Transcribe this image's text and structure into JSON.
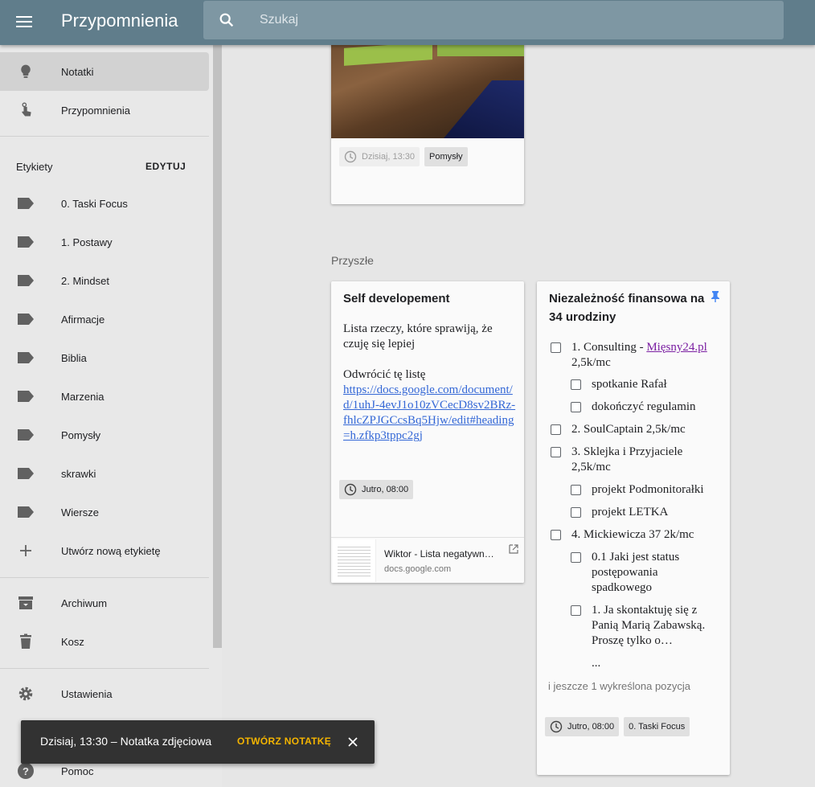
{
  "header": {
    "title": "Przypomnienia",
    "search_placeholder": "Szukaj"
  },
  "sidebar": {
    "notes": "Notatki",
    "reminders": "Przypomnienia",
    "labels_heading": "Etykiety",
    "edit_label": "EDYTUJ",
    "labels": [
      "0. Taski Focus",
      "1. Postawy",
      "2. Mindset",
      "Afirmacje",
      "Biblia",
      "Marzenia",
      "Pomysły",
      "skrawki",
      "Wiersze"
    ],
    "create_label": "Utwórz nową etykietę",
    "archive": "Archiwum",
    "trash": "Kosz",
    "settings": "Ustawienia",
    "help": "Pomoc"
  },
  "photo_card": {
    "time_chip": "Dzisiaj, 13:30",
    "label_chip": "Pomysły"
  },
  "section_past": "Przyszłe",
  "self_card": {
    "title": "Self developement",
    "line1": "Lista rzeczy, które sprawiją, że czuję się lepiej",
    "line2": "Odwrócić tę listę",
    "url": "https://docs.google.com/document/d/1uhJ-4evJ1o10zVCecD8sv2BRz-fhlcZPJGCcsBq5Hjw/edit#heading=h.zfkp3tppc2gj",
    "time_chip": "Jutro, 08:00",
    "preview_title": "Wiktor - Lista negatywn…",
    "preview_domain": "docs.google.com"
  },
  "finance_card": {
    "title": "Niezależność finansowa na 34 urodziny",
    "items": {
      "i1_prefix": "1. Consulting - ",
      "i1_link": "Mięsny24.pl",
      "i1_suffix": "2,5k/mc",
      "i1a": "spotkanie Rafał",
      "i1b": "dokończyć regulamin",
      "i2": "2. SoulCaptain 2,5k/mc",
      "i3": "3. Sklejka i Przyjaciele 2,5k/mc",
      "i3a": "projekt Podmonitorałki",
      "i3b": "projekt LETKA",
      "i4": "4. Mickiewicza 37 2k/mc",
      "i4a": "0.1 Jaki jest status postępowania spadkowego",
      "i4b": "1. Ja skontaktuję się z Panią Marią Zabawską. Proszę tylko o…",
      "ellipsis": "..."
    },
    "more": "i jeszcze 1 wykreślona pozycja",
    "time_chip": "Jutro, 08:00",
    "label_chip": "0. Taski Focus"
  },
  "snackbar": {
    "text": "Dzisiaj, 13:30 – Notatka zdjęciowa",
    "action": "OTWÓRZ NOTATKĘ"
  },
  "colors": {
    "header": "#607d8b",
    "accent": "#f4b400",
    "pin": "#4285f4"
  }
}
